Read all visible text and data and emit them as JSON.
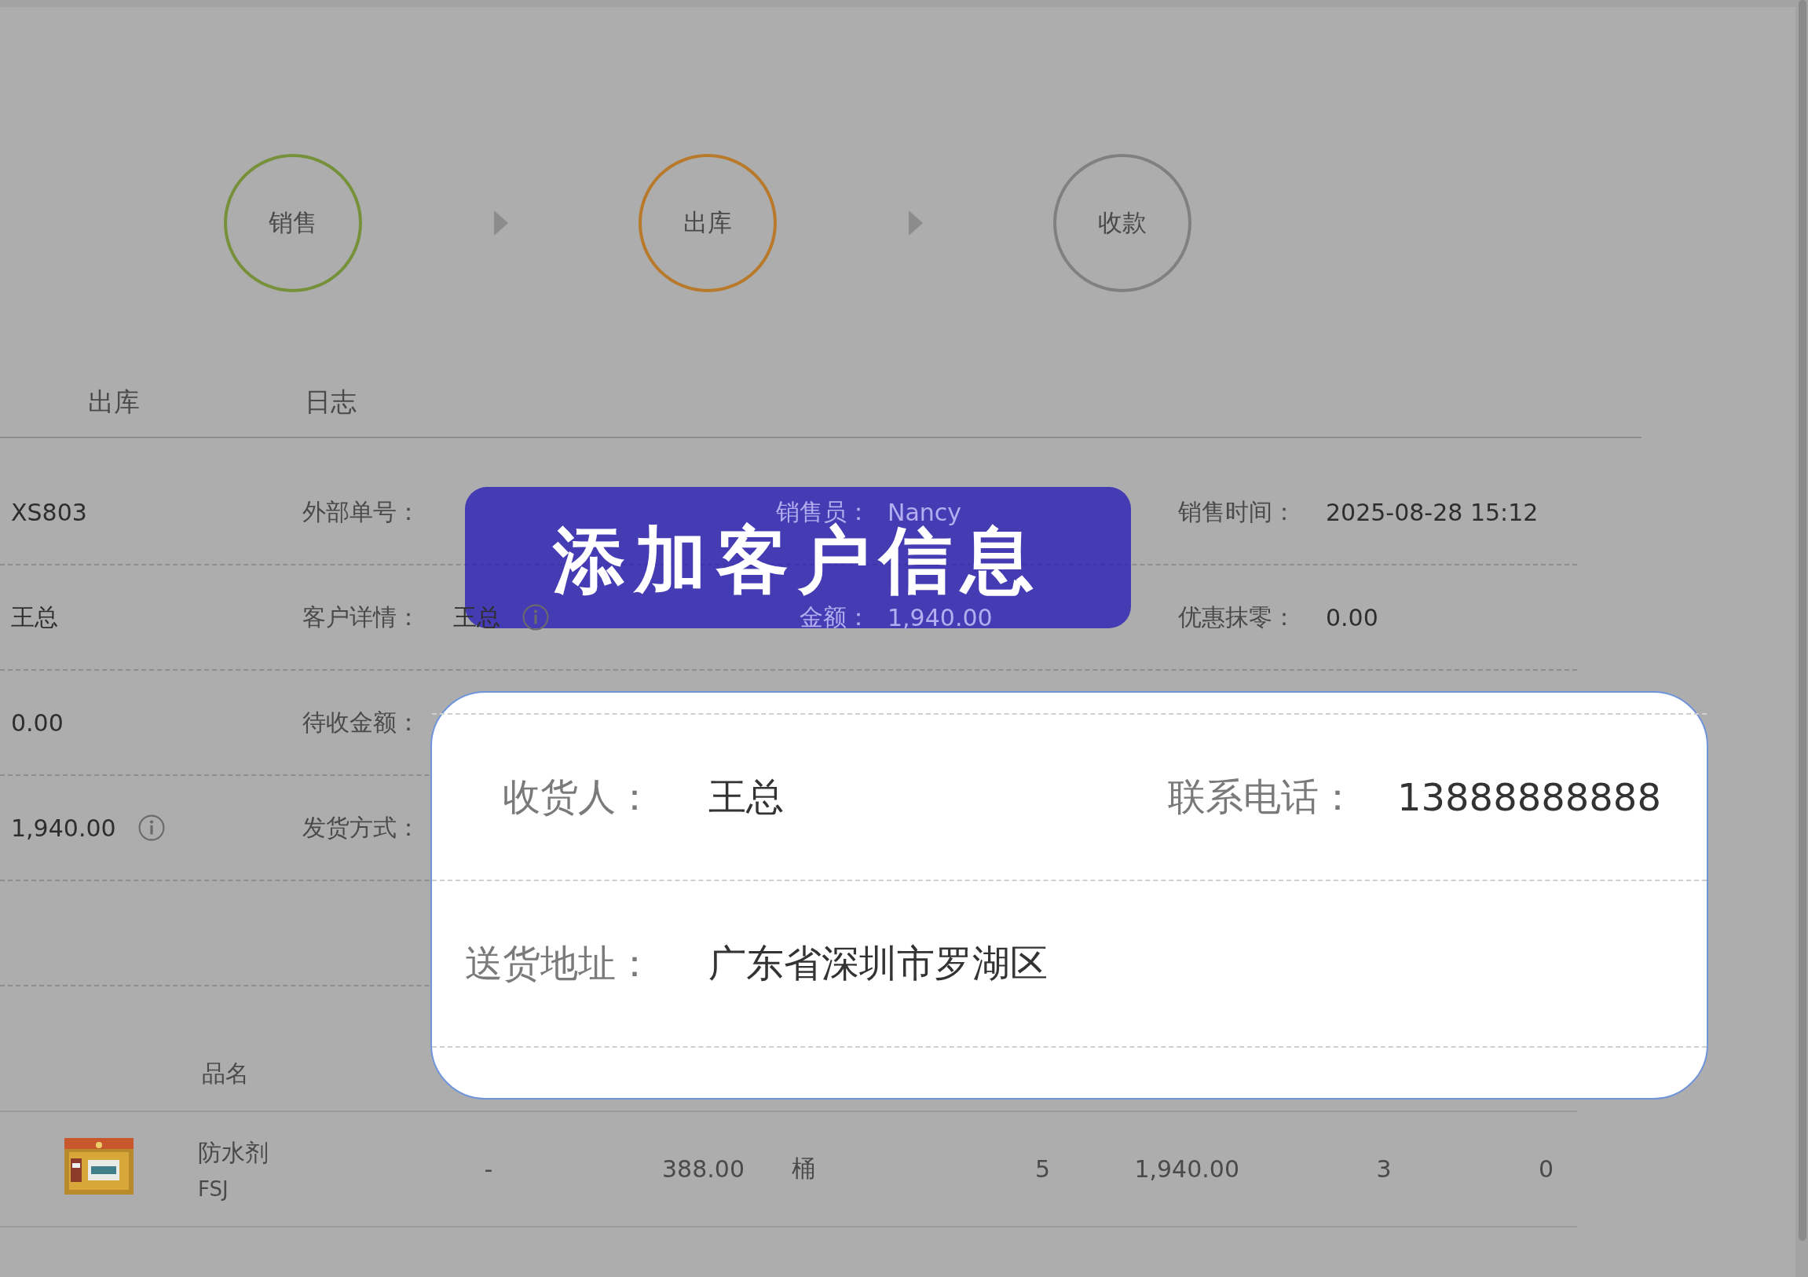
{
  "steps": [
    {
      "label": "销售",
      "color": "#76913a"
    },
    {
      "label": "出库",
      "color": "#b87a2a"
    },
    {
      "label": "收款",
      "color": "#808080"
    }
  ],
  "tabs": [
    {
      "label": "出库"
    },
    {
      "label": "日志"
    }
  ],
  "info_rows": [
    {
      "value": "XS803",
      "fields": [
        {
          "label": "外部单号："
        },
        {
          "label": "销售员：",
          "value": "Nancy"
        },
        {
          "label": "销售时间：",
          "value": "2025-08-28 15:12"
        }
      ]
    },
    {
      "value": "王总",
      "fields": [
        {
          "label": "客户详情：",
          "value": "王总",
          "info": true
        },
        {
          "label": "金额：",
          "value": "1,940.00"
        },
        {
          "label": "优惠抹零：",
          "value": "0.00"
        }
      ]
    },
    {
      "value": "0.00",
      "fields": [
        {
          "label": "待收金额："
        }
      ]
    },
    {
      "value": "1,940.00",
      "info": true,
      "fields": [
        {
          "label": "发货方式："
        }
      ]
    },
    {
      "fields": []
    }
  ],
  "table": {
    "columns": [
      {
        "label": "品名"
      }
    ],
    "rows": [
      {
        "name": "防水剂",
        "code": "FSJ",
        "cells": [
          "-",
          "388.00",
          "桶",
          "5",
          "1,940.00",
          "3",
          "0"
        ]
      }
    ]
  },
  "banner": {
    "title": "添加客户信息"
  },
  "delivery_card": {
    "rows": [
      [
        {
          "label": "收货人：",
          "value": "王总"
        },
        {
          "label": "联系电话：",
          "value": "13888888888"
        }
      ],
      [
        {
          "label": "送货地址：",
          "value": "广东省深圳市罗湖区"
        }
      ]
    ]
  }
}
